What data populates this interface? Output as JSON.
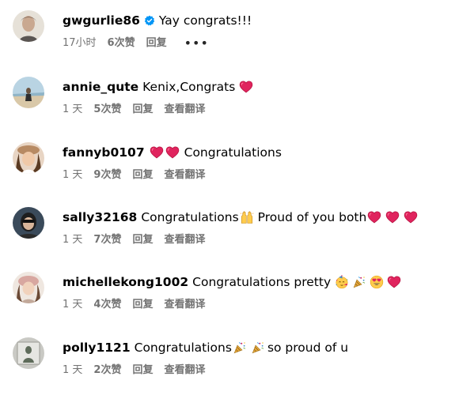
{
  "comments": [
    {
      "username": "gwgurlie86",
      "verified": true,
      "text": "Yay congrats!!!",
      "time": "17小时",
      "likes": "6次赞",
      "reply": "回复",
      "more": "•••",
      "emojis_after": []
    },
    {
      "username": "annie_qute",
      "text": "Kenix,Congrats",
      "emojis_after": [
        "red-heart"
      ],
      "time": "1 天",
      "likes": "5次赞",
      "reply": "回复",
      "translate": "查看翻译"
    },
    {
      "username": "fannyb0107",
      "text_before_emojis": "",
      "emojis_before": [
        "red-heart",
        "red-heart"
      ],
      "text": "Congratulations",
      "time": "1 天",
      "likes": "9次赞",
      "reply": "回复",
      "translate": "查看翻译"
    },
    {
      "username": "sally32168",
      "text": "Congratulations",
      "emojis_mid": [
        "raising-hands"
      ],
      "text2": "Proud of you both",
      "emojis_after": [
        "red-heart",
        "red-heart",
        "red-heart"
      ],
      "time": "1 天",
      "likes": "7次赞",
      "reply": "回复",
      "translate": "查看翻译"
    },
    {
      "username": "michellekong1002",
      "text": "Congratulations pretty",
      "emojis_after": [
        "partying-face",
        "party-popper",
        "heart-eyes",
        "red-heart"
      ],
      "time": "1 天",
      "likes": "4次赞",
      "reply": "回复",
      "translate": "查看翻译"
    },
    {
      "username": "polly1121",
      "text": "Congratulations",
      "emojis_mid": [
        "party-popper",
        "party-popper"
      ],
      "text2": "so proud of u",
      "time": "1 天",
      "likes": "2次赞",
      "reply": "回复",
      "translate": "查看翻译"
    }
  ],
  "colors": {
    "meta_text": "#737373",
    "verified_blue": "#0095f6",
    "heart_red": "#e0245e"
  }
}
